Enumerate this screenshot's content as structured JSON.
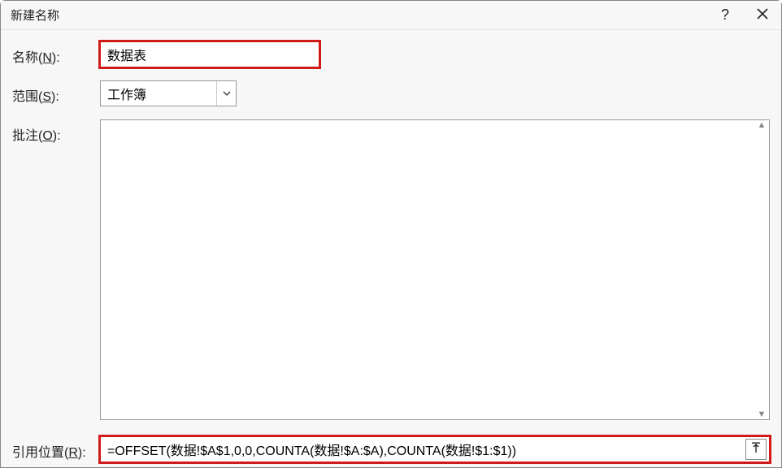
{
  "titlebar": {
    "title": "新建名称",
    "help_icon": "?",
    "close_icon": "✕"
  },
  "labels": {
    "name_pre": "名称(",
    "name_u": "N",
    "name_post": "):",
    "scope_pre": "范围(",
    "scope_u": "S",
    "scope_post": "):",
    "note_pre": "批注(",
    "note_u": "O",
    "note_post": "):",
    "ref_pre": "引用位置(",
    "ref_u": "R",
    "ref_post": "):"
  },
  "fields": {
    "name_value": "数据表",
    "scope_value": "工作簿",
    "comment_value": "",
    "ref_value": "=OFFSET(数据!$A$1,0,0,COUNTA(数据!$A:$A),COUNTA(数据!$1:$1))"
  },
  "icons": {
    "scroll_up": "▲",
    "scroll_down": "▼"
  }
}
